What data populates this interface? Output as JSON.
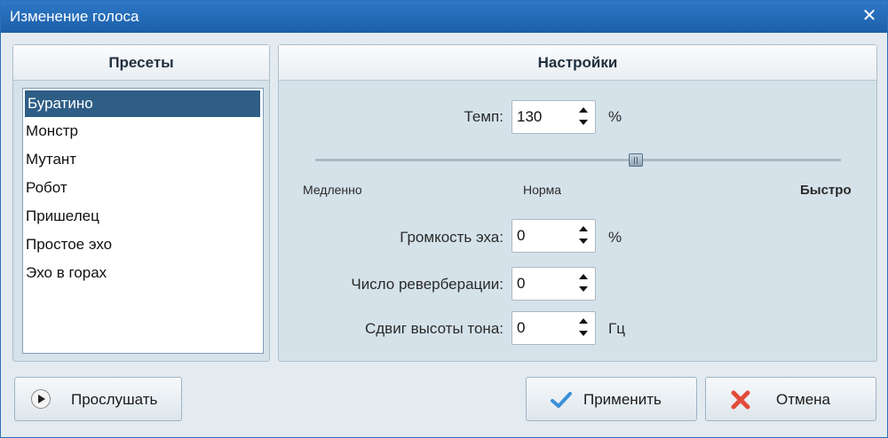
{
  "window": {
    "title": "Изменение голоса",
    "close_glyph": "✕"
  },
  "presets": {
    "header": "Пресеты",
    "items": [
      "Буратино",
      "Монстр",
      "Мутант",
      "Робот",
      "Пришелец",
      "Простое эхо",
      "Эхо в горах"
    ],
    "selected_index": 0
  },
  "settings": {
    "header": "Настройки",
    "tempo": {
      "label": "Темп:",
      "value": "130",
      "unit": "%"
    },
    "slider": {
      "min_label": "Медленно",
      "mid_label": "Норма",
      "max_label": "Быстро",
      "position_fraction": 0.6
    },
    "echo_volume": {
      "label": "Громкость эха:",
      "value": "0",
      "unit": "%"
    },
    "reverb_count": {
      "label": "Число реверберации:",
      "value": "0"
    },
    "pitch_shift": {
      "label": "Сдвиг высоты тона:",
      "value": "0",
      "unit": "Гц"
    }
  },
  "buttons": {
    "listen": "Прослушать",
    "apply": "Применить",
    "cancel": "Отмена"
  },
  "colors": {
    "titlebar": "#2e78c7",
    "selection": "#2e5d86",
    "check": "#3a8fd9",
    "cancel_x": "#e24b3b"
  }
}
